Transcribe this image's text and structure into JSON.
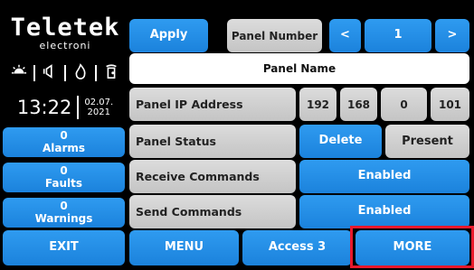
{
  "brand": {
    "logo": "Teletek",
    "sub": "electroni"
  },
  "status_icons": [
    "light-icon",
    "speaker-icon",
    "flame-icon",
    "door-icon"
  ],
  "clock": {
    "time": "13:22",
    "date_line1": "02.07.",
    "date_line2": "2021"
  },
  "side": {
    "alarms": {
      "count": "0",
      "label": "Alarms"
    },
    "faults": {
      "count": "0",
      "label": "Faults"
    },
    "warnings": {
      "count": "0",
      "label": "Warnings"
    },
    "exit": "EXIT"
  },
  "toolbar": {
    "apply": "Apply",
    "panel_number_label": "Panel Number",
    "prev": "<",
    "panel_number_value": "1",
    "next": ">"
  },
  "panel_name": "Panel Name",
  "rows": {
    "ip": {
      "label": "Panel IP Address",
      "octets": [
        "192",
        "168",
        "0",
        "101"
      ]
    },
    "status": {
      "label": "Panel Status",
      "delete": "Delete",
      "value": "Present"
    },
    "receive": {
      "label": "Receive Commands",
      "value": "Enabled"
    },
    "send": {
      "label": "Send Commands",
      "value": "Enabled"
    }
  },
  "bottom": {
    "menu": "MENU",
    "access": "Access 3",
    "more": "MORE"
  },
  "colors": {
    "accent_blue": "#1b82dc",
    "highlight_red": "#e8192c",
    "grey": "#cfcfcf"
  }
}
